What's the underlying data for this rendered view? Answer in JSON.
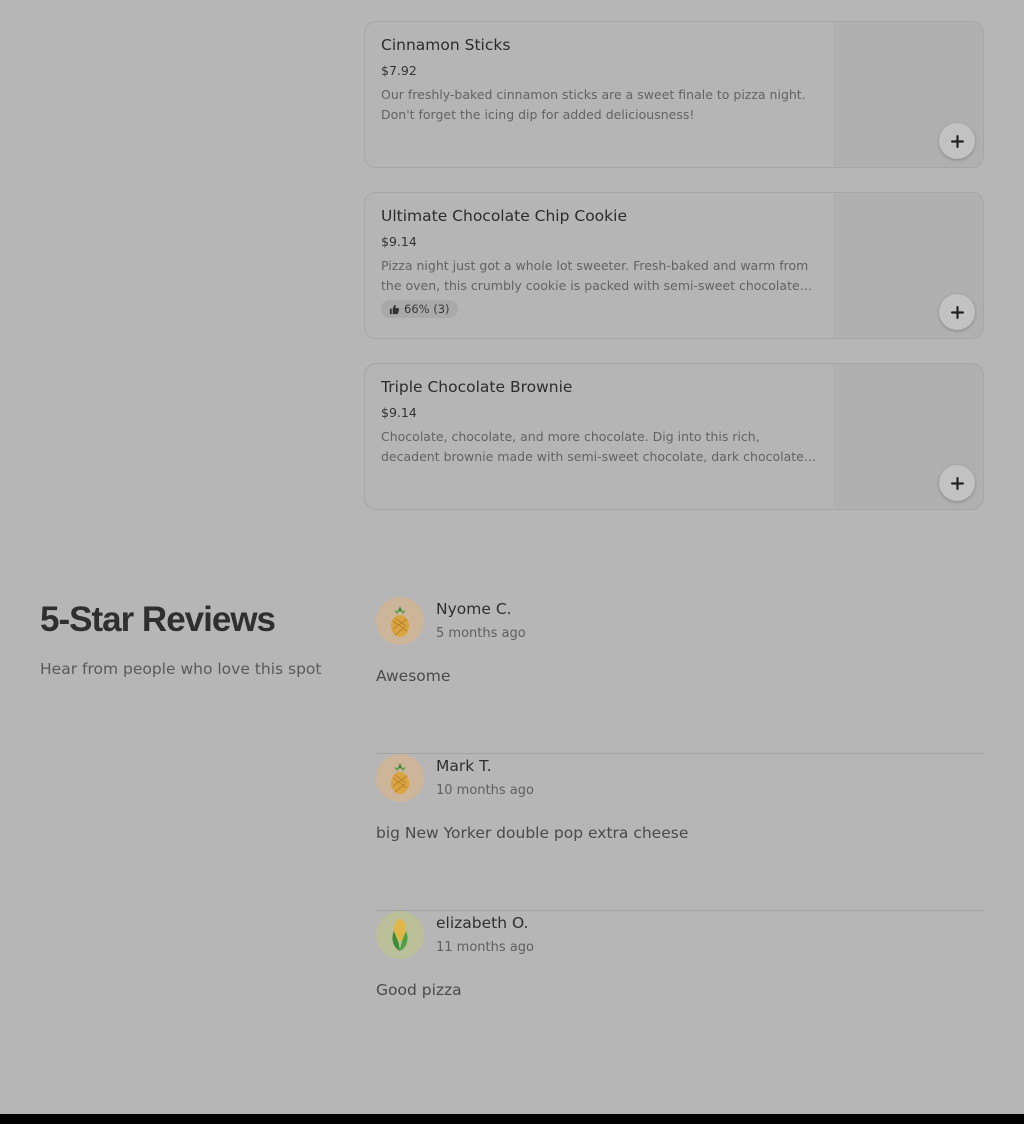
{
  "menu": {
    "items": [
      {
        "name": "Cinnamon Sticks",
        "price": "$7.92",
        "description": "Our freshly-baked cinnamon sticks are a sweet finale to pizza night. Don't forget the icing dip for added deliciousness!",
        "rating": ""
      },
      {
        "name": "Ultimate Chocolate Chip Cookie",
        "price": "$9.14",
        "description": "Pizza night just got a whole lot sweeter. Fresh-baked and warm from the oven, this crumbly cookie is packed with semi-sweet chocolate chips.",
        "rating": "66% (3)"
      },
      {
        "name": "Triple Chocolate Brownie",
        "price": "$9.14",
        "description": "Chocolate, chocolate, and more chocolate. Dig into this rich, decadent brownie made with semi-sweet chocolate, dark chocolate chips.",
        "rating": ""
      }
    ],
    "add_icon": "plus-icon",
    "rating_icon": "thumbs-up-icon"
  },
  "reviews": {
    "title": "5-Star Reviews",
    "subtitle": "Hear from people who love this spot",
    "items": [
      {
        "name": "Nyome C.",
        "time": "5 months ago",
        "text": "Awesome",
        "avatar_icon": "pineapple-icon"
      },
      {
        "name": "Mark T.",
        "time": "10 months ago",
        "text": "big New Yorker double pop extra cheese",
        "avatar_icon": "pineapple-icon"
      },
      {
        "name": "elizabeth O.",
        "time": "11 months ago",
        "text": "Good pizza",
        "avatar_icon": "corn-icon"
      }
    ]
  },
  "colors": {
    "overlay_bg": "#b6b6b6",
    "card_border": "#a6a6a6",
    "avatar_pineapple_bg": "#cdb59a",
    "avatar_corn_bg": "#bcc09a"
  }
}
